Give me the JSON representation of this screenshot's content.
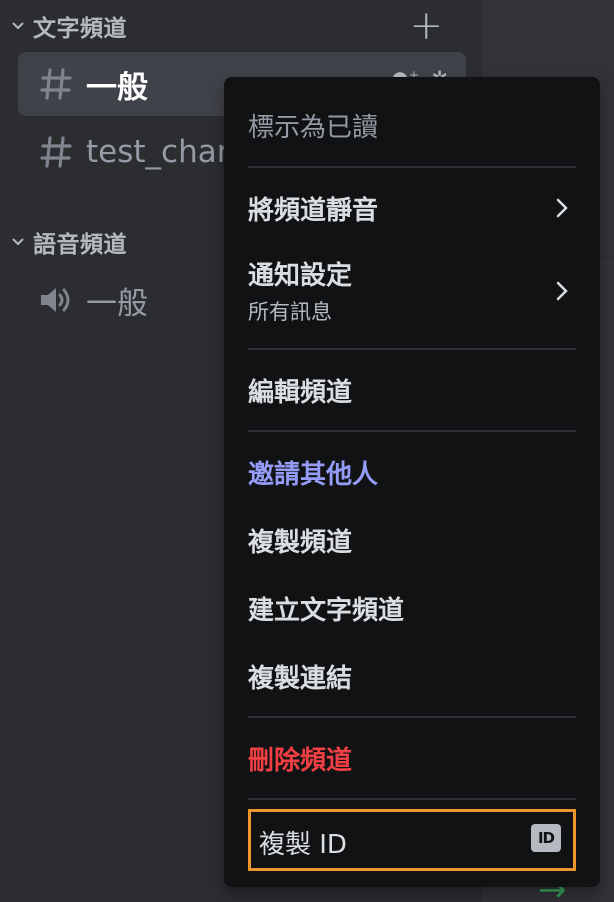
{
  "sidebar": {
    "text_category": {
      "label": "文字頻道"
    },
    "text_channels": [
      {
        "name": "一般",
        "selected": true
      },
      {
        "name": "test_chann",
        "selected": false
      }
    ],
    "voice_category": {
      "label": "語音頻道"
    },
    "voice_channels": [
      {
        "name": "一般"
      }
    ]
  },
  "context_menu": {
    "mark_read": "標示為已讀",
    "mute_channel": "將頻道靜音",
    "notification_settings": "通知設定",
    "notification_value": "所有訊息",
    "edit_channel": "編輯頻道",
    "invite_others": "邀請其他人",
    "duplicate_channel": "複製頻道",
    "create_text_channel": "建立文字頻道",
    "copy_link": "複製連結",
    "delete_channel": "刪除頻道",
    "copy_id": "複製 ID",
    "id_badge": "ID"
  },
  "colors": {
    "background": "#2b2d31",
    "menu_background": "#111214",
    "invite": "#949cf7",
    "danger": "#f23f43",
    "highlight_outline": "#f0962a"
  },
  "icons": {
    "category_collapse": "chevron-down-icon",
    "add_channel": "plus-icon",
    "text_channel": "hash-icon",
    "voice_channel": "speaker-icon",
    "submenu": "chevron-right-icon"
  }
}
